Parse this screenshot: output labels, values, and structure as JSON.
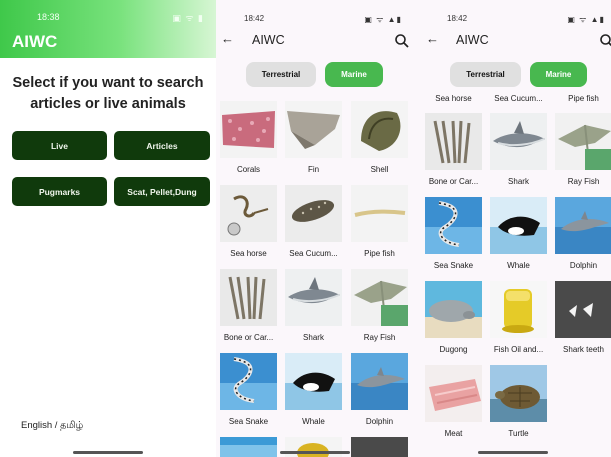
{
  "screen1": {
    "status_time": "18:38",
    "status_icons": "▣ ᯤ ▮",
    "app_title": "AIWC",
    "prompt_line1": "Select if you want to search",
    "prompt_line2": "articles or live animals",
    "buttons": {
      "live": "Live",
      "articles": "Articles",
      "pugmarks": "Pugmarks",
      "scat": "Scat, Pellet,Dung"
    },
    "language_toggle": "English / தமிழ்"
  },
  "screen2": {
    "status_time": "18:42",
    "status_icons": "▣ ᯤ ▲▮",
    "title": "AIWC",
    "tabs": {
      "terrestrial": "Terrestrial",
      "marine": "Marine"
    },
    "items": [
      {
        "label": "Corals",
        "icon": "coral-photo"
      },
      {
        "label": "Fin",
        "icon": "fin-photo"
      },
      {
        "label": "Shell",
        "icon": "shell-photo"
      },
      {
        "label": "Sea horse",
        "icon": "seahorse-photo"
      },
      {
        "label": "Sea Cucum...",
        "icon": "sea-cucumber-photo"
      },
      {
        "label": "Pipe fish",
        "icon": "pipefish-photo"
      },
      {
        "label": "Bone or Car...",
        "icon": "bone-photo"
      },
      {
        "label": "Shark",
        "icon": "shark-photo"
      },
      {
        "label": "Ray Fish",
        "icon": "ray-fish-photo"
      },
      {
        "label": "Sea Snake",
        "icon": "sea-snake-photo"
      },
      {
        "label": "Whale",
        "icon": "whale-photo"
      },
      {
        "label": "Dolphin",
        "icon": "dolphin-photo"
      }
    ]
  },
  "screen3": {
    "status_time": "18:42",
    "status_icons": "▣ ᯤ ▲▮",
    "title": "AIWC",
    "tabs": {
      "terrestrial": "Terrestrial",
      "marine": "Marine"
    },
    "partial_labels": [
      "Sea horse",
      "Sea Cucum...",
      "Pipe fish"
    ],
    "items": [
      {
        "label": "Bone or Car...",
        "icon": "bone-photo"
      },
      {
        "label": "Shark",
        "icon": "shark-photo"
      },
      {
        "label": "Ray Fish",
        "icon": "ray-fish-photo"
      },
      {
        "label": "Sea Snake",
        "icon": "sea-snake-photo"
      },
      {
        "label": "Whale",
        "icon": "whale-photo"
      },
      {
        "label": "Dolphin",
        "icon": "dolphin-photo"
      },
      {
        "label": "Dugong",
        "icon": "dugong-photo"
      },
      {
        "label": "Fish Oil and...",
        "icon": "fish-oil-photo"
      },
      {
        "label": "Shark teeth",
        "icon": "shark-teeth-photo"
      },
      {
        "label": "Meat",
        "icon": "meat-photo"
      },
      {
        "label": "Turtle",
        "icon": "turtle-photo"
      }
    ]
  },
  "colors": {
    "brand_green": "#3fc84a",
    "dark_button": "#103a0c",
    "selected_tab": "#48b84f",
    "unselected_tab": "#e0e0e0"
  }
}
